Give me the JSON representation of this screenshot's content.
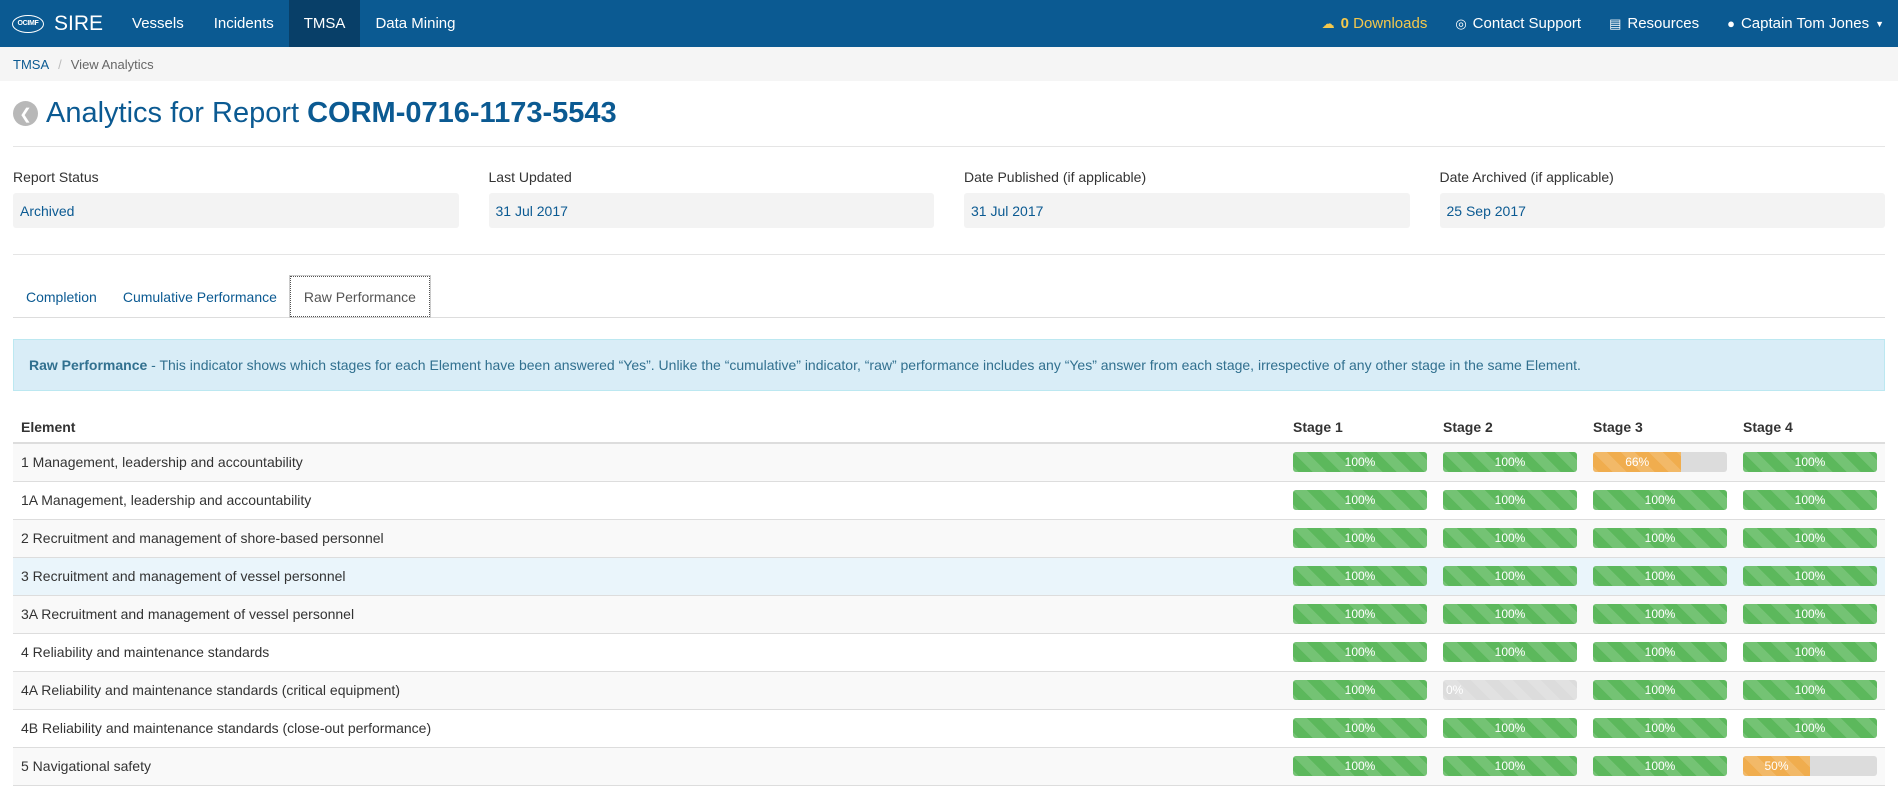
{
  "navbar": {
    "logo_text": "OCIMF",
    "brand": "SIRE",
    "items": [
      {
        "label": "Vessels",
        "active": false
      },
      {
        "label": "Incidents",
        "active": false
      },
      {
        "label": "TMSA",
        "active": true
      },
      {
        "label": "Data Mining",
        "active": false
      }
    ],
    "downloads_count": "0",
    "downloads_label": "Downloads",
    "contact_label": "Contact Support",
    "resources_label": "Resources",
    "user_label": "Captain Tom Jones"
  },
  "breadcrumb": {
    "root": "TMSA",
    "current": "View Analytics"
  },
  "title": {
    "prefix": "Analytics for Report",
    "report_id": "CORM-0716-1173-5543"
  },
  "meta": {
    "status_label": "Report Status",
    "status_value": "Archived",
    "updated_label": "Last Updated",
    "updated_value": "31 Jul 2017",
    "published_label": "Date Published (if applicable)",
    "published_value": "31 Jul 2017",
    "archived_label": "Date Archived (if applicable)",
    "archived_value": "25 Sep 2017"
  },
  "tabs": [
    "Completion",
    "Cumulative Performance",
    "Raw Performance"
  ],
  "info": {
    "heading": "Raw Performance",
    "text": " - This indicator shows which stages for each Element have been answered “Yes”. Unlike the “cumulative” indicator, “raw” performance includes any “Yes” answer from each stage, irrespective of any other stage in the same Element."
  },
  "table": {
    "headers": [
      "Element",
      "Stage 1",
      "Stage 2",
      "Stage 3",
      "Stage 4"
    ],
    "rows": [
      {
        "element": "1 Management, leadership and accountability",
        "stages": [
          100,
          100,
          66,
          100
        ]
      },
      {
        "element": "1A Management, leadership and accountability",
        "stages": [
          100,
          100,
          100,
          100
        ]
      },
      {
        "element": "2 Recruitment and management of shore-based personnel",
        "stages": [
          100,
          100,
          100,
          100
        ]
      },
      {
        "element": "3 Recruitment and management of vessel personnel",
        "stages": [
          100,
          100,
          100,
          100
        ]
      },
      {
        "element": "3A Recruitment and management of vessel personnel",
        "stages": [
          100,
          100,
          100,
          100
        ]
      },
      {
        "element": "4 Reliability and maintenance standards",
        "stages": [
          100,
          100,
          100,
          100
        ]
      },
      {
        "element": "4A Reliability and maintenance standards (critical equipment)",
        "stages": [
          100,
          0,
          100,
          100
        ]
      },
      {
        "element": "4B Reliability and maintenance standards (close-out performance)",
        "stages": [
          100,
          100,
          100,
          100
        ]
      },
      {
        "element": "5 Navigational safety",
        "stages": [
          100,
          100,
          100,
          50
        ]
      }
    ]
  },
  "colors": {
    "primary": "#0b5a92",
    "success": "#5cb85c",
    "warning": "#f0ad4e",
    "accent": "#f5c84c"
  }
}
